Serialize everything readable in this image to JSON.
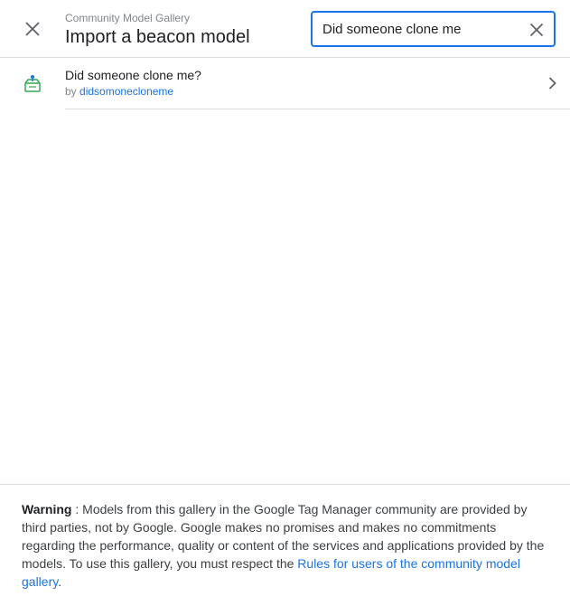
{
  "header": {
    "subtitle": "Community Model Gallery",
    "title": "Import a beacon model",
    "close_icon": "close-icon"
  },
  "search": {
    "value": "Did someone clone me",
    "clear_icon": "clear-icon"
  },
  "results": [
    {
      "title": "Did someone clone me?",
      "by_prefix": "by",
      "author": "didsomonecloneme",
      "icon": "beacon-model-icon",
      "chevron": "chevron-right-icon"
    }
  ],
  "footer": {
    "warning_label": "Warning",
    "warning_text": " : Models from this gallery in the Google Tag Manager community are provided by third parties, not by Google. Google makes no promises and makes no commitments regarding the performance, quality or content of the services and applications provided by the models. To use this gallery, you must respect the ",
    "link_text": "Rules for users of the community model gallery",
    "trailing": "."
  },
  "colors": {
    "accent": "#1a73e8",
    "icon_green": "#34a853",
    "divider": "#dadce0"
  }
}
